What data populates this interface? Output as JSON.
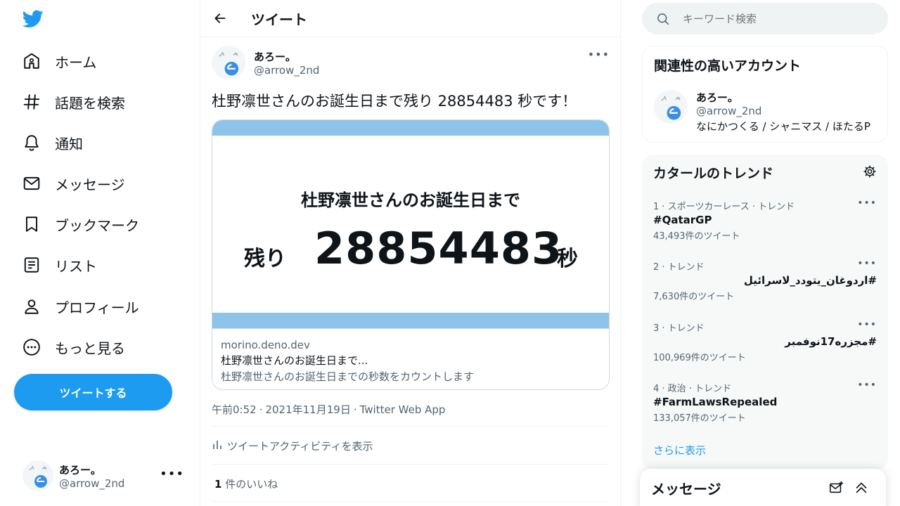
{
  "nav": {
    "items": [
      {
        "label": "ホーム",
        "icon": "home-icon"
      },
      {
        "label": "話題を検索",
        "icon": "hashtag-icon"
      },
      {
        "label": "通知",
        "icon": "bell-icon"
      },
      {
        "label": "メッセージ",
        "icon": "envelope-icon"
      },
      {
        "label": "ブックマーク",
        "icon": "bookmark-icon"
      },
      {
        "label": "リスト",
        "icon": "list-icon"
      },
      {
        "label": "プロフィール",
        "icon": "person-icon"
      },
      {
        "label": "もっと見る",
        "icon": "more-circle-icon"
      }
    ],
    "tweet_button": "ツイートする",
    "account": {
      "name": "あろー。",
      "handle": "@arrow_2nd"
    }
  },
  "main": {
    "header_title": "ツイート",
    "author": {
      "name": "あろー。",
      "handle": "@arrow_2nd"
    },
    "text": "杜野凛世さんのお誕生日まで残り 28854483 秒です！",
    "card": {
      "image_line1": "杜野凛世さんのお誕生日まで",
      "image_remain": "残り",
      "image_number": "28854483",
      "image_unit": "秒",
      "domain": "morino.deno.dev",
      "title": "杜野凛世さんのお誕生日まで...",
      "description": "杜野凛世さんのお誕生日までの秒数をカウントします"
    },
    "meta": {
      "time": "午前0:52",
      "date": "2021年11月19日",
      "source": "Twitter Web App"
    },
    "activity_label": "ツイートアクティビティを表示",
    "likes": {
      "count": "1",
      "label": "件のいいね"
    }
  },
  "sidebar": {
    "search_placeholder": "キーワード検索",
    "related": {
      "title": "関連性の高いアカウント",
      "name": "あろー。",
      "handle": "@arrow_2nd",
      "bio": "なにかつくる / シャニマス / ほたるP"
    },
    "trends": {
      "title": "カタールのトレンド",
      "items": [
        {
          "context": "1 · スポーツカーレース · トレンド",
          "tag": "#QatarGP",
          "count": "43,493件のツイート"
        },
        {
          "context": "2 · トレンド",
          "tag": "#اردوغان_يتودد_لاسرائيل",
          "count": "7,630件のツイート"
        },
        {
          "context": "3 · トレンド",
          "tag": "#مجزره17نوفمبر",
          "count": "100,969件のツイート"
        },
        {
          "context": "4 · 政治 · トレンド",
          "tag": "#FarmLawsRepealed",
          "count": "133,057件のツイート"
        }
      ],
      "show_more": "さらに表示"
    },
    "messages_title": "メッセージ"
  },
  "colors": {
    "accent": "#1d9bf0",
    "card_bar": "#8ec4ea",
    "text_secondary": "#536471"
  }
}
